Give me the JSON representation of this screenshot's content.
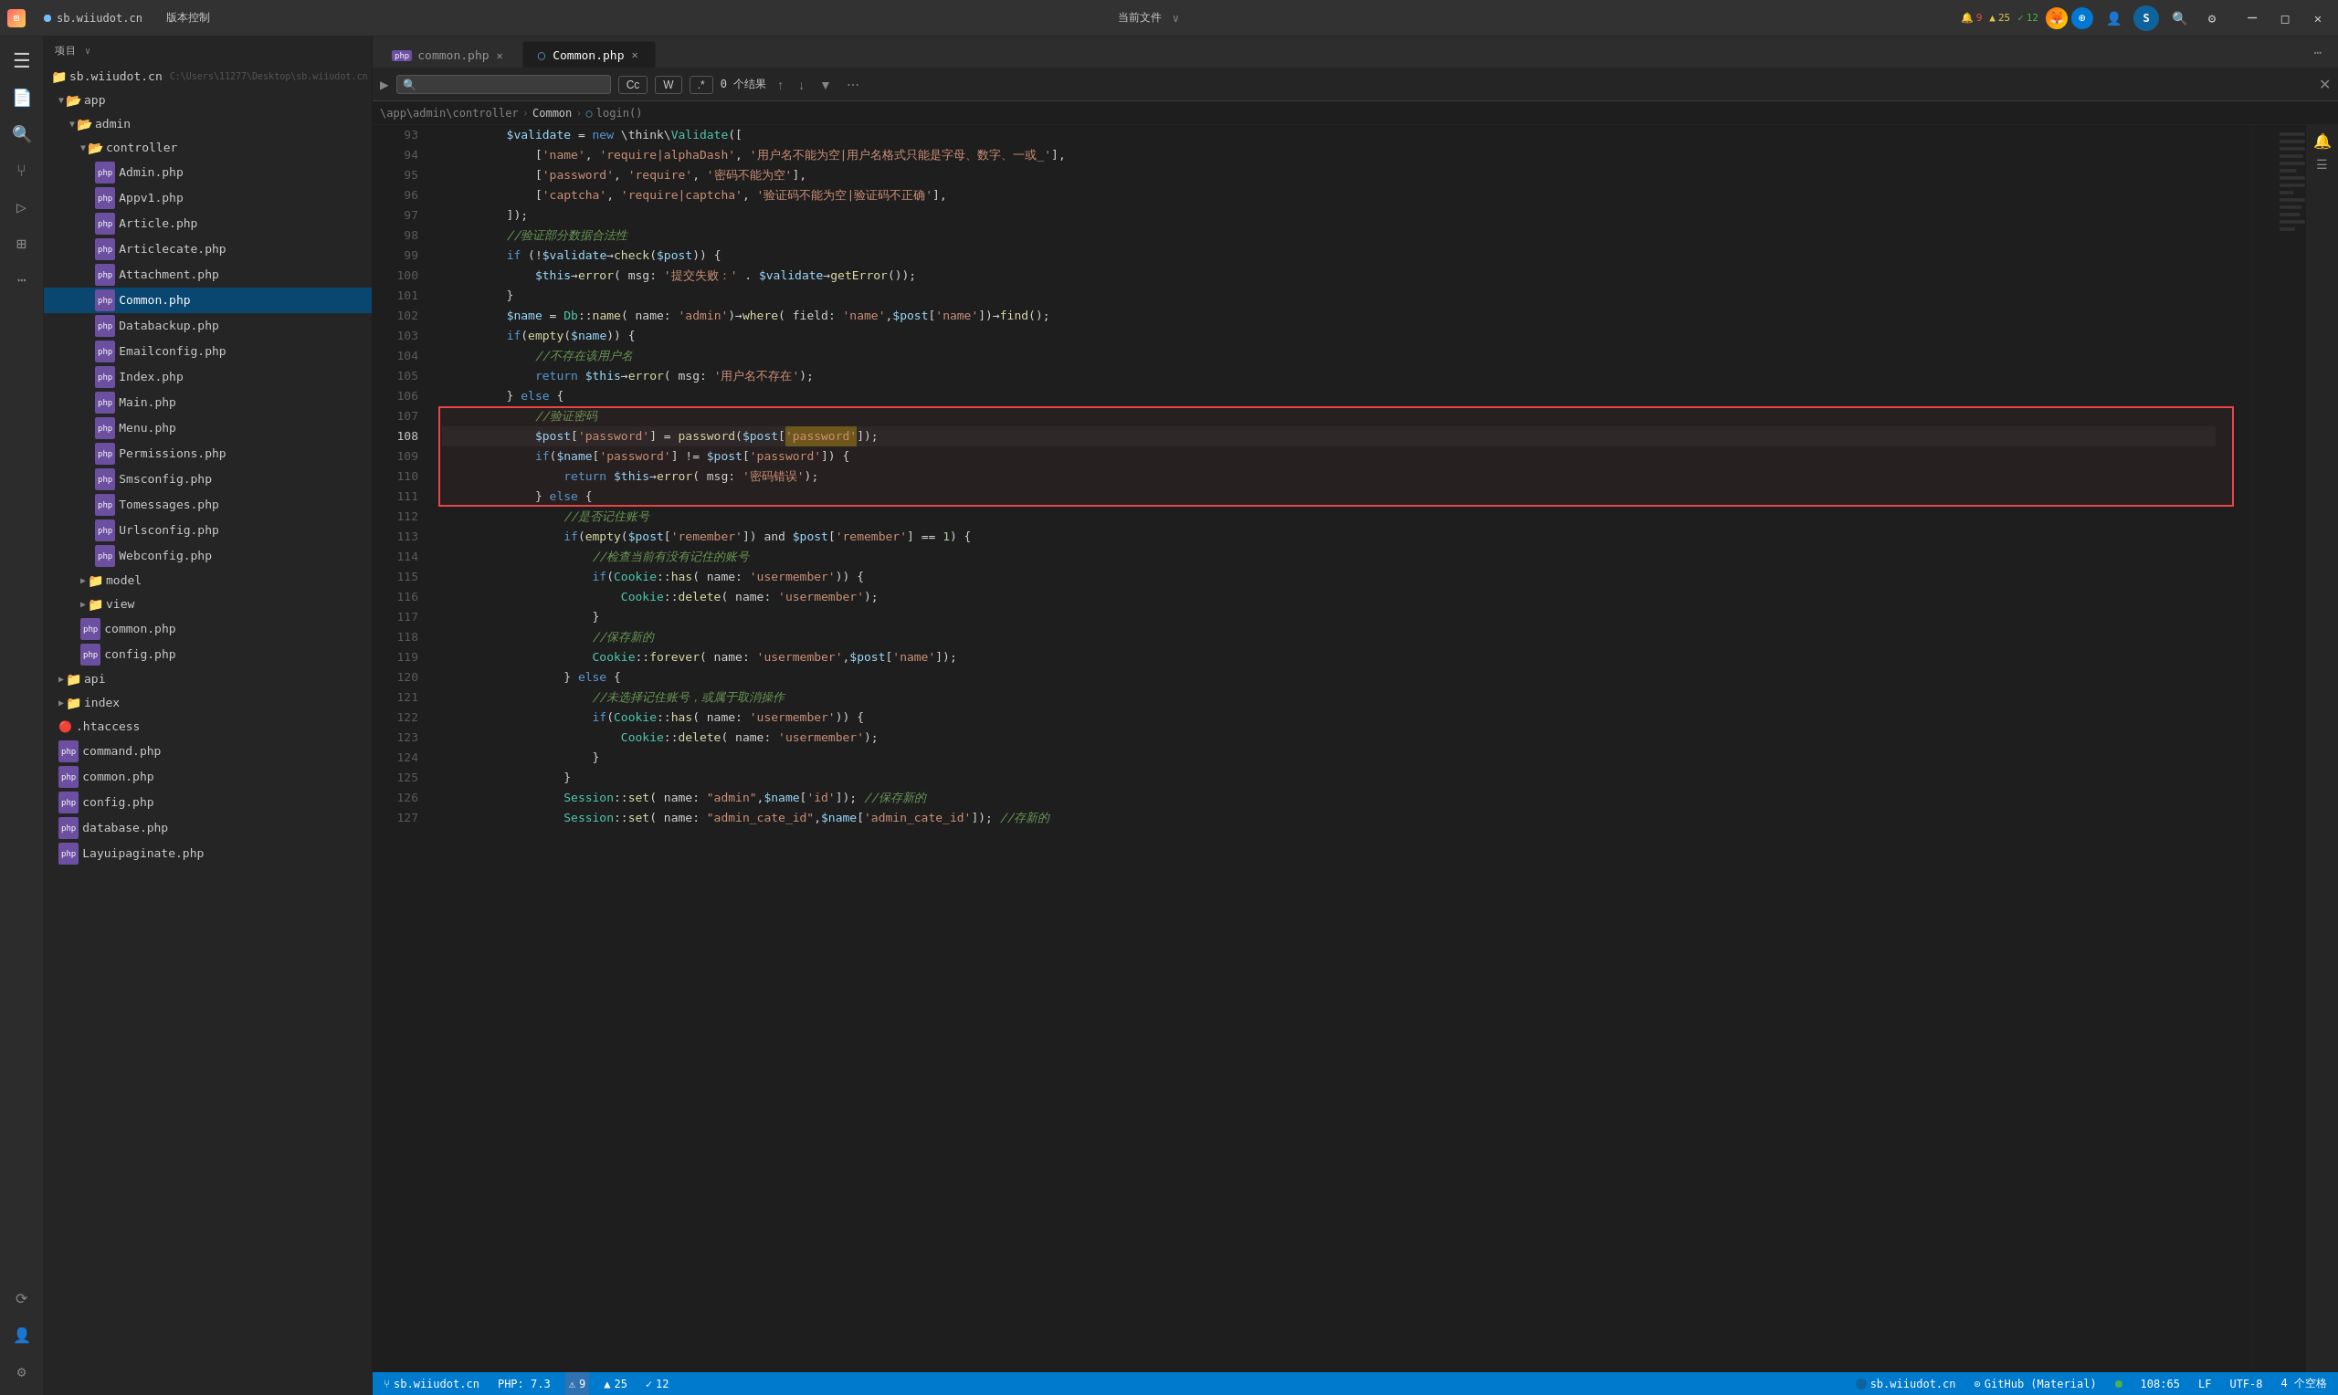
{
  "titlebar": {
    "app_name": "项目",
    "tab1_label": "sb.wiiudot.cn",
    "tab2_label": "版本控制",
    "center_text": "当前文件",
    "project_path": "sb.wiiudot.cn C:\\Users\\11277\\Desktop\\sb.wiiudot.cn"
  },
  "sidebar": {
    "header": "项目",
    "items": [
      {
        "label": "sb.wiiudot.cn",
        "type": "root",
        "indent": 0
      },
      {
        "label": "app",
        "type": "folder",
        "indent": 1
      },
      {
        "label": "admin",
        "type": "folder",
        "indent": 2
      },
      {
        "label": "controller",
        "type": "folder",
        "indent": 3
      },
      {
        "label": "Admin.php",
        "type": "php",
        "indent": 4
      },
      {
        "label": "Appv1.php",
        "type": "php",
        "indent": 4
      },
      {
        "label": "Article.php",
        "type": "php",
        "indent": 4
      },
      {
        "label": "Articlecate.php",
        "type": "php",
        "indent": 4
      },
      {
        "label": "Attachment.php",
        "type": "php",
        "indent": 4
      },
      {
        "label": "Common.php",
        "type": "php",
        "indent": 4,
        "selected": true
      },
      {
        "label": "Databackup.php",
        "type": "php",
        "indent": 4
      },
      {
        "label": "Emailconfig.php",
        "type": "php",
        "indent": 4
      },
      {
        "label": "Index.php",
        "type": "php",
        "indent": 4
      },
      {
        "label": "Main.php",
        "type": "php",
        "indent": 4
      },
      {
        "label": "Menu.php",
        "type": "php",
        "indent": 4
      },
      {
        "label": "Permissions.php",
        "type": "php",
        "indent": 4
      },
      {
        "label": "Smsconfig.php",
        "type": "php",
        "indent": 4
      },
      {
        "label": "Tomessages.php",
        "type": "php",
        "indent": 4
      },
      {
        "label": "Urlsconfig.php",
        "type": "php",
        "indent": 4
      },
      {
        "label": "Webconfig.php",
        "type": "php",
        "indent": 4
      },
      {
        "label": "model",
        "type": "folder",
        "indent": 3
      },
      {
        "label": "view",
        "type": "folder",
        "indent": 3
      },
      {
        "label": "common.php",
        "type": "php",
        "indent": 3
      },
      {
        "label": "config.php",
        "type": "php",
        "indent": 3
      },
      {
        "label": "api",
        "type": "folder",
        "indent": 1
      },
      {
        "label": "index",
        "type": "folder",
        "indent": 1
      },
      {
        "label": ".htaccess",
        "type": "file",
        "indent": 1
      },
      {
        "label": "command.php",
        "type": "php",
        "indent": 1
      },
      {
        "label": "common.php",
        "type": "php",
        "indent": 1
      },
      {
        "label": "config.php",
        "type": "php",
        "indent": 1
      },
      {
        "label": "database.php",
        "type": "php",
        "indent": 1
      },
      {
        "label": "Layuipaginate.php",
        "type": "php",
        "indent": 1
      }
    ]
  },
  "editor": {
    "tabs": [
      {
        "label": "common.php",
        "type": "php",
        "active": false
      },
      {
        "label": "Common.php",
        "type": "php",
        "active": true
      }
    ],
    "search": {
      "placeholder": "",
      "result_count": "0 个结果"
    },
    "breadcrumb": [
      "\\app\\admin\\controller",
      "Common",
      "login()"
    ]
  },
  "code_lines": [
    {
      "num": "93",
      "content": "        $validate = new \\think\\Validate(["
    },
    {
      "num": "94",
      "content": "            ['name', 'require|alphaDash', '用户名不能为空|用户名格式只能是字母、数字、一或_'],"
    },
    {
      "num": "95",
      "content": "            ['password', 'require', '密码不能为空'],"
    },
    {
      "num": "96",
      "content": "            ['captcha', 'require|captcha', '验证码不能为空|验证码不正确'],"
    },
    {
      "num": "97",
      "content": "        ]);"
    },
    {
      "num": "98",
      "content": "        //验证部分数据合法性"
    },
    {
      "num": "99",
      "content": "        if (!$validate→check($post)) {"
    },
    {
      "num": "100",
      "content": "            $this→error( msg: '提交失败：' . $validate→getError());"
    },
    {
      "num": "101",
      "content": "        }"
    },
    {
      "num": "102",
      "content": "        $name = Db::name( name: 'admin')→where( field: 'name',$post['name'])→find();"
    },
    {
      "num": "103",
      "content": "        if(empty($name)) {"
    },
    {
      "num": "104",
      "content": "            //不存在该用户名"
    },
    {
      "num": "105",
      "content": "            return $this→error( msg: '用户名不存在');"
    },
    {
      "num": "106",
      "content": "        } else {"
    },
    {
      "num": "107",
      "content": "            //验证密码"
    },
    {
      "num": "108",
      "content": "            $post['password'] = password($post['password']);",
      "highlight": true,
      "active": true
    },
    {
      "num": "109",
      "content": "            if($name['password'] != $post['password']) {",
      "highlight": true
    },
    {
      "num": "110",
      "content": "                return $this→error( msg: '密码错误');",
      "highlight": true
    },
    {
      "num": "111",
      "content": "            } else {",
      "highlight": true
    },
    {
      "num": "112",
      "content": "                //是否记住账号"
    },
    {
      "num": "113",
      "content": "                if(empty($post['remember']) and $post['remember'] == 1) {"
    },
    {
      "num": "114",
      "content": "                    //检查当前有没有记住的账号"
    },
    {
      "num": "115",
      "content": "                    if(Cookie::has( name: 'usermember')) {"
    },
    {
      "num": "116",
      "content": "                        Cookie::delete( name: 'usermember');"
    },
    {
      "num": "117",
      "content": "                    }"
    },
    {
      "num": "118",
      "content": "                    //保存新的"
    },
    {
      "num": "119",
      "content": "                    Cookie::forever( name: 'usermember',$post['name']);"
    },
    {
      "num": "120",
      "content": "                } else {"
    },
    {
      "num": "121",
      "content": "                    //未选择记住账号，或属于取消操作"
    },
    {
      "num": "122",
      "content": "                    if(Cookie::has( name: 'usermember')) {"
    },
    {
      "num": "123",
      "content": "                        Cookie::delete( name: 'usermember');"
    },
    {
      "num": "124",
      "content": "                    }"
    },
    {
      "num": "125",
      "content": "                }"
    },
    {
      "num": "126",
      "content": "                Session::set( name: \"admin\",$name['id']); //保存新的"
    },
    {
      "num": "127",
      "content": "                Session::set( name: \"admin_cate_id\",$name['admin_cate_id']); //存新的"
    }
  ],
  "status_bar": {
    "branch": "sb.wiiudot.cn",
    "github": "GitHub (Material)",
    "php_version": "PHP: 7.3",
    "encoding": "UTF-8",
    "line_col": "108:65",
    "line_ending": "LF",
    "spaces": "4 个空格",
    "errors": "9",
    "warnings": "25",
    "ok": "12"
  },
  "badges": {
    "errors": "9",
    "warnings": "25",
    "ok": "12"
  }
}
